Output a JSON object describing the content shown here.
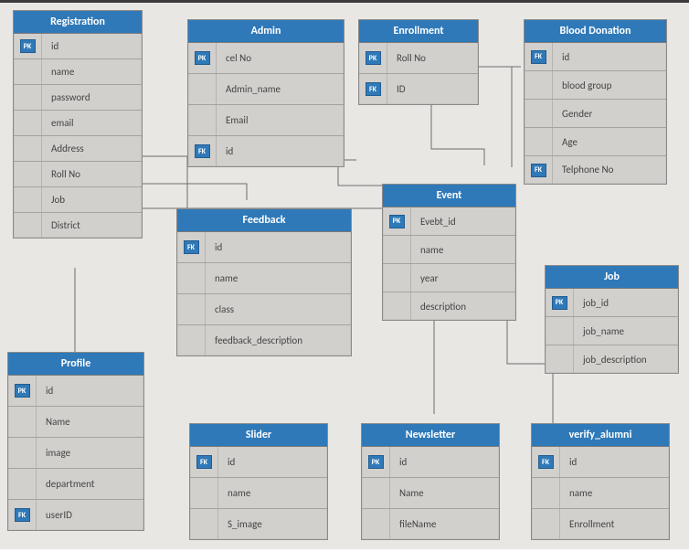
{
  "entities": {
    "registration": {
      "title": "Registration",
      "fields": [
        {
          "key": "PK",
          "name": "id"
        },
        {
          "key": "",
          "name": "name"
        },
        {
          "key": "",
          "name": "password"
        },
        {
          "key": "",
          "name": "email"
        },
        {
          "key": "",
          "name": "Address"
        },
        {
          "key": "",
          "name": "Roll No"
        },
        {
          "key": "",
          "name": "Job"
        },
        {
          "key": "",
          "name": "District"
        }
      ]
    },
    "admin": {
      "title": "Admin",
      "fields": [
        {
          "key": "PK",
          "name": "cel No"
        },
        {
          "key": "",
          "name": "Admin_name"
        },
        {
          "key": "",
          "name": "Email"
        },
        {
          "key": "FK",
          "name": "id"
        }
      ]
    },
    "enrollment": {
      "title": "Enrollment",
      "fields": [
        {
          "key": "PK",
          "name": "Roll No"
        },
        {
          "key": "FK",
          "name": "ID"
        }
      ]
    },
    "blood": {
      "title": "Blood Donation",
      "fields": [
        {
          "key": "FK",
          "name": "id"
        },
        {
          "key": "",
          "name": "blood group"
        },
        {
          "key": "",
          "name": "Gender"
        },
        {
          "key": "",
          "name": "Age"
        },
        {
          "key": "FK",
          "name": "Telphone No"
        }
      ]
    },
    "feedback": {
      "title": "Feedback",
      "fields": [
        {
          "key": "FK",
          "name": "id"
        },
        {
          "key": "",
          "name": "name"
        },
        {
          "key": "",
          "name": "class"
        },
        {
          "key": "",
          "name": "feedback_description"
        }
      ]
    },
    "event": {
      "title": "Event",
      "fields": [
        {
          "key": "PK",
          "name": "Evebt_id"
        },
        {
          "key": "",
          "name": "name"
        },
        {
          "key": "",
          "name": "year"
        },
        {
          "key": "",
          "name": "description"
        }
      ]
    },
    "job": {
      "title": "Job",
      "fields": [
        {
          "key": "PK",
          "name": "job_id"
        },
        {
          "key": "",
          "name": "job_name"
        },
        {
          "key": "",
          "name": "job_description"
        }
      ]
    },
    "profile": {
      "title": "Profile",
      "fields": [
        {
          "key": "PK",
          "name": "id"
        },
        {
          "key": "",
          "name": "Name"
        },
        {
          "key": "",
          "name": "image"
        },
        {
          "key": "",
          "name": "department"
        },
        {
          "key": "FK",
          "name": "userID"
        }
      ]
    },
    "slider": {
      "title": "Slider",
      "fields": [
        {
          "key": "FK",
          "name": "id"
        },
        {
          "key": "",
          "name": "name"
        },
        {
          "key": "",
          "name": "S_image"
        }
      ]
    },
    "newsletter": {
      "title": "Newsletter",
      "fields": [
        {
          "key": "PK",
          "name": "id"
        },
        {
          "key": "",
          "name": "Name"
        },
        {
          "key": "",
          "name": "fileName"
        }
      ]
    },
    "verify": {
      "title": "verify_alumni",
      "fields": [
        {
          "key": "FK",
          "name": "id"
        },
        {
          "key": "",
          "name": "name"
        },
        {
          "key": "",
          "name": "Enrollment"
        }
      ]
    }
  },
  "key_labels": {
    "PK": "PK",
    "FK": "FK"
  }
}
